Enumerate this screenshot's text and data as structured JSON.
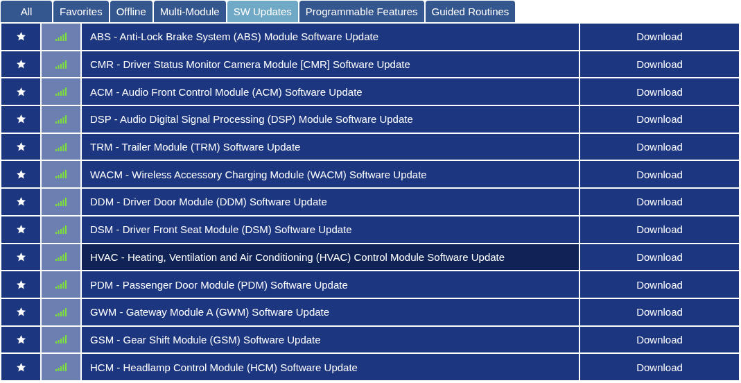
{
  "tabs": [
    {
      "label": "All",
      "selected": false
    },
    {
      "label": "Favorites",
      "selected": false
    },
    {
      "label": "Offline",
      "selected": false
    },
    {
      "label": "Multi-Module",
      "selected": false
    },
    {
      "label": "SW Updates",
      "selected": true
    },
    {
      "label": "Programmable Features",
      "selected": false
    },
    {
      "label": "Guided Routines",
      "selected": false
    }
  ],
  "rows": [
    {
      "name": "ABS - Anti-Lock Brake System (ABS) Module Software Update",
      "action": "Download",
      "highlighted": false
    },
    {
      "name": "CMR - Driver Status Monitor Camera Module [CMR] Software Update",
      "action": "Download",
      "highlighted": false
    },
    {
      "name": "ACM - Audio Front Control Module (ACM) Software Update",
      "action": "Download",
      "highlighted": false
    },
    {
      "name": "DSP - Audio Digital Signal Processing (DSP) Module Software Update",
      "action": "Download",
      "highlighted": false
    },
    {
      "name": "TRM - Trailer Module (TRM) Software Update",
      "action": "Download",
      "highlighted": false
    },
    {
      "name": "WACM - Wireless Accessory Charging Module (WACM) Software Update",
      "action": "Download",
      "highlighted": false
    },
    {
      "name": "DDM - Driver Door Module (DDM) Software Update",
      "action": "Download",
      "highlighted": false
    },
    {
      "name": "DSM - Driver Front Seat Module (DSM) Software Update",
      "action": "Download",
      "highlighted": false
    },
    {
      "name": "HVAC - Heating, Ventilation and Air Conditioning (HVAC) Control Module Software Update",
      "action": "Download",
      "highlighted": true
    },
    {
      "name": "PDM - Passenger Door Module (PDM) Software Update",
      "action": "Download",
      "highlighted": false
    },
    {
      "name": "GWM - Gateway Module A (GWM) Software Update",
      "action": "Download",
      "highlighted": false
    },
    {
      "name": "GSM - Gear Shift Module (GSM) Software Update",
      "action": "Download",
      "highlighted": false
    },
    {
      "name": "HCM - Headlamp Control Module (HCM) Software Update",
      "action": "Download",
      "highlighted": false
    }
  ]
}
